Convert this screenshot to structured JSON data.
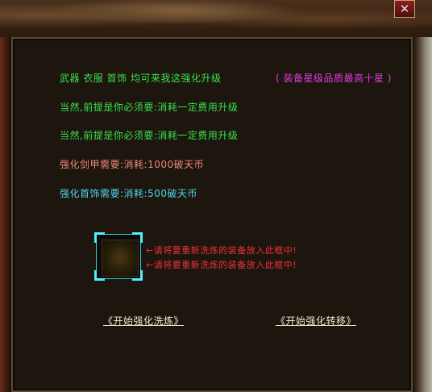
{
  "window": {
    "close_label": "✕"
  },
  "info": {
    "line1": "武器 衣服 首饰 均可来我这强化升级",
    "line1_note": "( 装备星级品质最高十星 )",
    "line2": "当然,前提是你必须要:消耗一定费用升级",
    "line3": "当然,前提是你必须要:消耗一定费用升级",
    "line4": "强化剑甲需要:消耗:1000破天币",
    "line5": "强化首饰需要:消耗:500破天币"
  },
  "slot": {
    "hint1": "←请将要重新洗炼的装备放入此框中!",
    "hint2": "←请将要重新洗炼的装备放入此框中!"
  },
  "actions": {
    "refine_label": "《开始强化洗炼》",
    "transfer_label": "《开始强化转移》"
  },
  "colors": {
    "green": "#3be04c",
    "magenta": "#e23ae0",
    "salmon": "#f08a78",
    "cyan": "#4fd6ea",
    "red": "#f0303a",
    "slot_border": "#2bd0e0"
  }
}
